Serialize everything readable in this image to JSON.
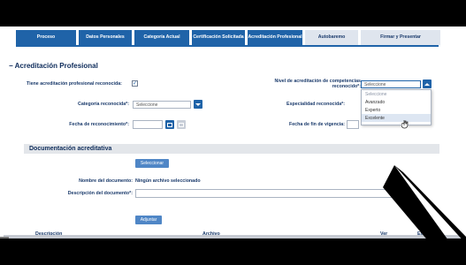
{
  "tabs": [
    {
      "label": "Proceso",
      "active": true
    },
    {
      "label": "Datos Personales",
      "active": true
    },
    {
      "label": "Categoría Actual",
      "active": true
    },
    {
      "label": "Certificación Solicitada",
      "active": true
    },
    {
      "label": "Acreditación Profesional",
      "active": true
    },
    {
      "label": "Autobaremo",
      "active": false
    },
    {
      "label": "Firmar y Presentar",
      "active": false
    }
  ],
  "section": {
    "title": "− Acreditación Profesional"
  },
  "form": {
    "tiene_label": "Tiene acreditación profesional reconocida:",
    "tiene_checked": "✓",
    "nivel_label_1": "Nivel de acreditación de competencias",
    "nivel_label_2": "reconocido*:",
    "nivel_value": "Seleccione",
    "categoria_label": "Categoría reconocida*:",
    "categoria_value": "Seleccione",
    "especialidad_label": "Especialidad reconocida*:",
    "fecha_reco_label": "Fecha de reconocimiento*:",
    "fecha_fin_label": "Fecha de fin de vigencia:"
  },
  "dropdown": {
    "options": [
      "Seleccione",
      "Avanzado",
      "Experto",
      "Excelente"
    ],
    "highlighted": "Excelente"
  },
  "documentacion": {
    "title": "Documentación acreditativa",
    "select_button": "Seleccionar",
    "nombre_label": "Nombre del documento:",
    "nombre_value": "Ningún archivo seleccionado",
    "descripcion_label": "Descripción del documento*:",
    "adjuntar_button": "Adjuntar"
  },
  "table": {
    "headers": [
      "Descripción",
      "Archivo",
      "Ver",
      "Eliminar"
    ]
  },
  "colors": {
    "accent": "#1f63a8",
    "text": "#1a3a6b"
  }
}
